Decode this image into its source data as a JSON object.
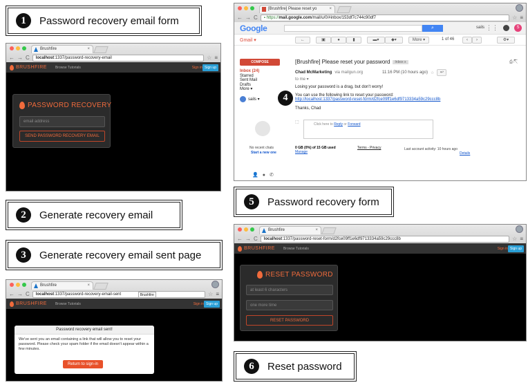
{
  "steps": [
    {
      "num": "1",
      "label": "Password recovery email form"
    },
    {
      "num": "2",
      "label": "Generate recovery email"
    },
    {
      "num": "3",
      "label": "Generate recovery email sent page"
    },
    {
      "num": "4",
      "label": ""
    },
    {
      "num": "5",
      "label": "Password recovery form"
    },
    {
      "num": "6",
      "label": "Reset password"
    }
  ],
  "shot1": {
    "tab_title": "Brushfire",
    "url_host": "localhost",
    "url_rest": ":1337/password-recovery-email",
    "brand": "BRUSHFIRE",
    "browse": "Browse Tutorials",
    "sign_in": "Sign in",
    "sign_up": "Sign up",
    "panel_title": "PASSWORD RECOVERY",
    "email_placeholder": "email address",
    "send_button": "SEND PASSWORD RECOVERY EMAIL"
  },
  "shot3": {
    "tab_title": "Brushfire",
    "url_host": "localhost",
    "url_rest": ":1337/password-recovery-email-sent",
    "tooltip": "Brushfire",
    "brand": "BRUSHFIRE",
    "browse": "Browse Tutorials",
    "sign_in": "Sign in",
    "sign_up": "Sign up",
    "dialog_title": "Password recovery email sent!",
    "dialog_text": "We've sent you an email containing a link that will allow you to reset your password. Please check your spam folder if the email doesn't appear within a few minutes.",
    "return_button": "Return to sign-in"
  },
  "gmail": {
    "tab_title": "[Brushfire] Please reset yo",
    "url_scheme": "https://",
    "url_host": "mail.google.com",
    "url_rest": "/mail/u/0/#inbox/153df7c744c90df7",
    "logo": "Google",
    "user": "sails",
    "avatar": "S",
    "gmail_label": "Gmail ▾",
    "pager": "1 of 46",
    "more": "More ▾",
    "compose": "COMPOSE",
    "folders": [
      "Inbox (24)",
      "Starred",
      "Sent Mail",
      "Drafts",
      "More ▾"
    ],
    "chat_user": "sails ▾",
    "subject": "[Brushfire] Please reset your password",
    "inbox_tag": "Inbox x",
    "sender": "Chad McMarketing",
    "via": "via mailgun.org",
    "time": "11:16 PM (10 hours ago)",
    "to": "to me ▾",
    "line1": "Losing your password is a drag, but don't worry!",
    "line2": "You can use the following link to reset your password:",
    "reset_link": "http://localhost:1337/password-reset-form/d2fce09ff1e6df9713334a59c29ccc8b",
    "signoff": "Thanks, Chad",
    "reply_hint_pre": "Click here to ",
    "reply": "Reply",
    "or": " or ",
    "forward": "Forward",
    "no_chats": "No recent chats",
    "start_new": "Start a new one",
    "storage": "0 GB (0%) of 15 GB used",
    "manage": "Manage",
    "terms": "Terms - Privacy",
    "activity": "Last account activity: 10 hours ago",
    "details": "Details"
  },
  "shot6": {
    "tab_title": "Brushfire",
    "url_host": "localhost",
    "url_rest": ":1337/password-reset-form/d2fce09ff1e6df9713334a59c29ccc8b",
    "brand": "BRUSHFIRE",
    "browse": "Browse Tutorials",
    "sign_in": "Sign in",
    "sign_up": "Sign up",
    "panel_title": "RESET PASSWORD",
    "pw_placeholder": "at least 6 characters",
    "confirm_placeholder": "one more time",
    "reset_button": "RESET PASSWORD"
  },
  "colors": {
    "brand": "#f06b3c",
    "signup": "#2a9fd6",
    "gmail_red": "#d14836",
    "google_blue": "#4285f4"
  }
}
